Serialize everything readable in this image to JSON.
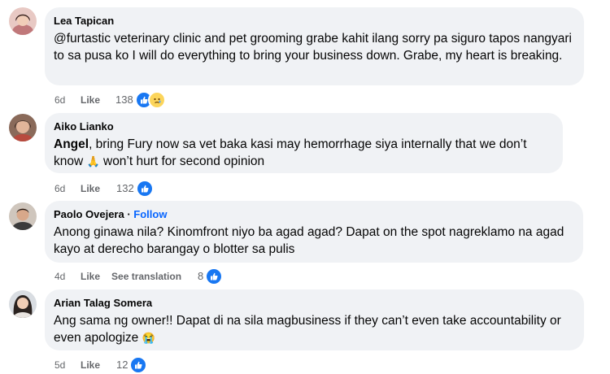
{
  "comments": [
    {
      "author": "Lea Tapican",
      "text": "@furtastic veterinary clinic and pet grooming grabe kahit ilang sorry pa siguro tapos nangyari to sa pusa ko I will do everything to bring your business down. Grabe, my heart is breaking.",
      "age": "6d",
      "like": "Like",
      "reaction_count": "138",
      "reaction_icons": [
        "like-icon",
        "sad-icon"
      ]
    },
    {
      "author": "Aiko Lianko",
      "mention": "Angel",
      "text_part1": ", bring Fury now sa vet baka kasi may hemorrhage siya internally that we don’t know ",
      "emoji": "🙏",
      "text_part2": " won’t hurt for second opinion",
      "age": "6d",
      "like": "Like",
      "reaction_count": "132",
      "reaction_icons": [
        "like-icon"
      ]
    },
    {
      "author": "Paolo Ovejera",
      "separator": " · ",
      "follow": "Follow",
      "text": "Anong ginawa nila? Kinomfront niyo ba agad agad? Dapat on the spot nagreklamo na agad kayo at derecho barangay o blotter sa pulis",
      "age": "4d",
      "like": "Like",
      "see_translation": "See translation",
      "reaction_count": "8",
      "reaction_icons": [
        "like-icon"
      ]
    },
    {
      "author": "Arian Talag Somera",
      "text": "Ang sama ng owner!! Dapat di na sila magbusiness if they can’t even take accountability or even apologize ",
      "emoji": "😭",
      "age": "5d",
      "like": "Like",
      "reaction_count": "12",
      "reaction_icons": [
        "like-icon"
      ]
    }
  ],
  "colors": {
    "bubble": "#f0f2f5",
    "meta_text": "#65676b",
    "like_blue": "#1877f2",
    "follow_blue": "#0866ff",
    "sad_yellow": "#fcd55b"
  }
}
